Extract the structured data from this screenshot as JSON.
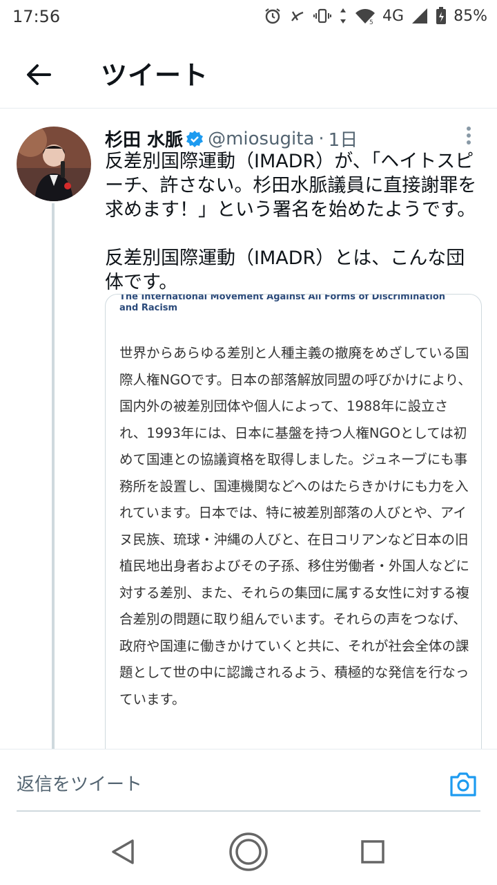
{
  "status_bar": {
    "time": "17:56",
    "network": "4G",
    "battery": "85%"
  },
  "header": {
    "title": "ツイート"
  },
  "tweet": {
    "author_name": "杉田 水脈",
    "handle": "@miosugita",
    "separator": "·",
    "time": "1日",
    "text_p1": "反差別国際運動（IMADR）が、「ヘイトスピーチ、許さない。杉田水脈議員に直接謝罪を求めます！」という署名を始めたようです。",
    "text_p2": "反差別国際運動（IMADR）とは、こんな団体です。"
  },
  "card": {
    "heading": "The International Movement Against All Forms of Discrimination and Racism",
    "body": "世界からあらゆる差別と人種主義の撤廃をめざしている国際人権NGOです。日本の部落解放同盟の呼びかけにより、国内外の被差別団体や個人によって、1988年に設立され、1993年には、日本に基盤を持つ人権NGOとしては初めて国連との協議資格を取得しました。ジュネーブにも事務所を設置し、国連機関などへのはたらきかけにも力を入れています。日本では、特に被差別部落の人びとや、アイヌ民族、琉球・沖縄の人びと、在日コリアンなど日本の旧植民地出身者およびその子孫、移住労働者・外国人などに対する差別、また、それらの集団に属する女性に対する複合差別の問題に取り組んでいます。それらの声をつなげ、政府や国連に働きかけていくと共に、それが社会全体の課題として世の中に認識されるよう、積極的な発信を行なっています。"
  },
  "reply": {
    "placeholder": "返信をツイート"
  },
  "icons": {
    "back": "arrow-left-icon",
    "verified": "verified-badge-icon",
    "more": "more-vertical-icon",
    "camera": "camera-icon",
    "nav_back": "triangle-back-icon",
    "nav_home": "circle-home-icon",
    "nav_recents": "square-recents-icon"
  },
  "colors": {
    "accent": "#1d9bf0",
    "text": "#0f1419",
    "secondary": "#536471"
  }
}
